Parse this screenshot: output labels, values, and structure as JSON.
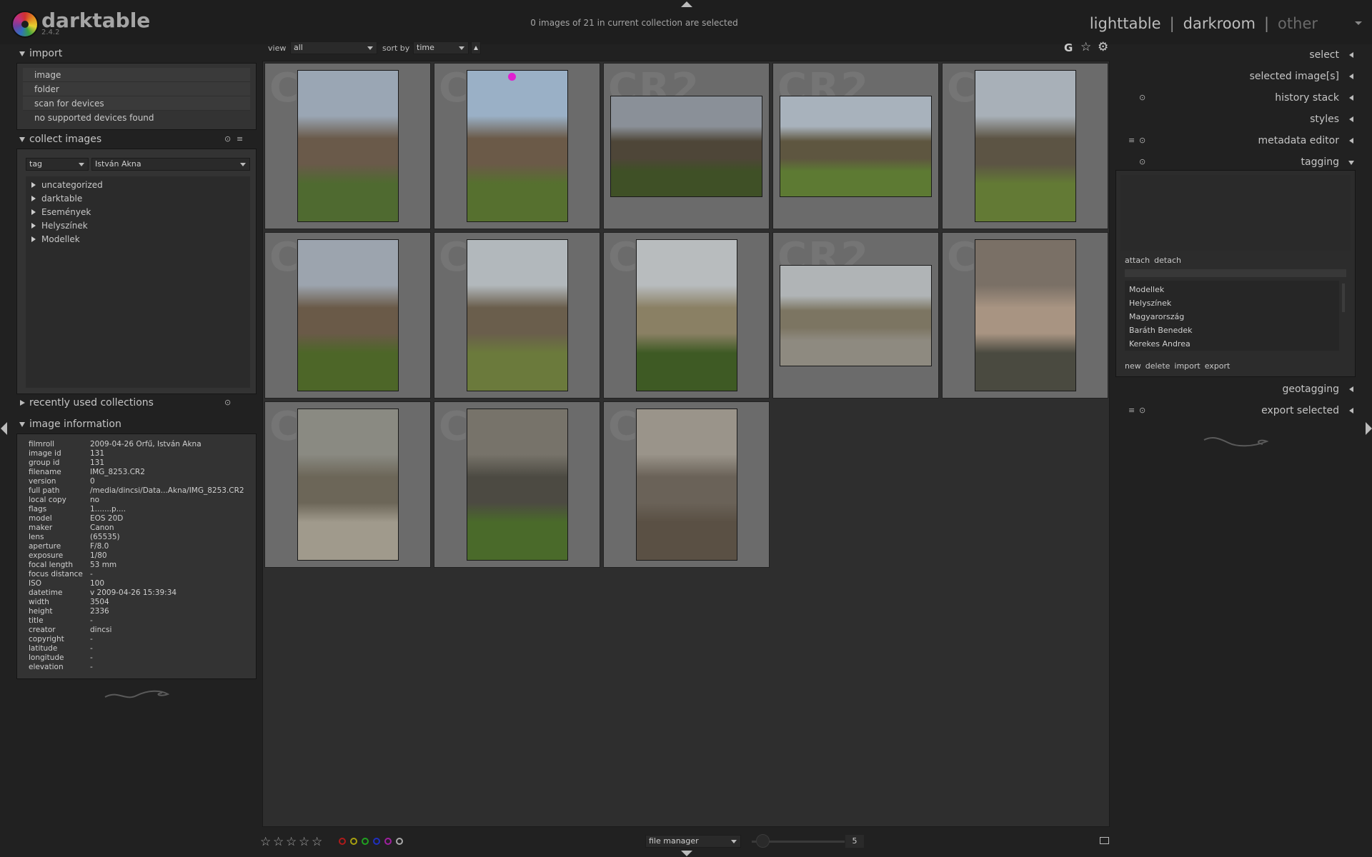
{
  "app": {
    "name": "darktable",
    "version": "2.4.2"
  },
  "header": {
    "selection_info": "0 images of 21 in current collection are selected",
    "views": {
      "lighttable": "lighttable",
      "sep": "|",
      "darkroom": "darkroom",
      "other": "other"
    }
  },
  "left": {
    "import": {
      "title": "import",
      "items": [
        "image",
        "folder",
        "scan for devices"
      ],
      "note": "no supported devices found"
    },
    "collect": {
      "title": "collect images",
      "property": "tag",
      "value": "István Akna",
      "tree": [
        "uncategorized",
        "darktable",
        "Események",
        "Helyszínek",
        "Modellek"
      ]
    },
    "recent": {
      "title": "recently used collections"
    },
    "info": {
      "title": "image information",
      "rows": [
        {
          "k": "filmroll",
          "v": "2009-04-26 Orfű, István Akna"
        },
        {
          "k": "image id",
          "v": "131"
        },
        {
          "k": "group id",
          "v": "131"
        },
        {
          "k": "filename",
          "v": "IMG_8253.CR2"
        },
        {
          "k": "version",
          "v": "0"
        },
        {
          "k": "full path",
          "v": "/media/dincsi/Data...Akna/IMG_8253.CR2"
        },
        {
          "k": "local copy",
          "v": "no"
        },
        {
          "k": "flags",
          "v": "1.......p...."
        },
        {
          "k": "model",
          "v": "EOS 20D"
        },
        {
          "k": "maker",
          "v": "Canon"
        },
        {
          "k": "lens",
          "v": "(65535)"
        },
        {
          "k": "aperture",
          "v": "F/8.0"
        },
        {
          "k": "exposure",
          "v": "1/80"
        },
        {
          "k": "focal length",
          "v": "53 mm"
        },
        {
          "k": "focus distance",
          "v": "-"
        },
        {
          "k": "ISO",
          "v": "100"
        },
        {
          "k": "datetime",
          "v": "v 2009-04-26 15:39:34"
        },
        {
          "k": "width",
          "v": "3504"
        },
        {
          "k": "height",
          "v": "2336"
        },
        {
          "k": "title",
          "v": "-"
        },
        {
          "k": "creator",
          "v": "dincsi"
        },
        {
          "k": "copyright",
          "v": "-"
        },
        {
          "k": "latitude",
          "v": "-"
        },
        {
          "k": "longitude",
          "v": "-"
        },
        {
          "k": "elevation",
          "v": "-"
        }
      ]
    }
  },
  "toolbar": {
    "view_label": "view",
    "view_value": "all",
    "sort_label": "sort by",
    "sort_value": "time",
    "g_label": "G"
  },
  "grid": {
    "watermark": "CR2",
    "images": [
      {
        "orient": "portrait",
        "colors": [
          "#9aa6b4",
          "#6a5a4a",
          "#4f6a30"
        ]
      },
      {
        "orient": "portrait",
        "colors": [
          "#9ab0c6",
          "#6b5a48",
          "#56702f"
        ],
        "mark": true
      },
      {
        "orient": "landscape",
        "colors": [
          "#8a9098",
          "#4e4638",
          "#3f5026"
        ]
      },
      {
        "orient": "landscape",
        "colors": [
          "#a8b2bc",
          "#5e5640",
          "#5d7a33"
        ]
      },
      {
        "orient": "portrait",
        "colors": [
          "#a8b0b8",
          "#5c5444",
          "#637a35"
        ]
      },
      {
        "orient": "portrait",
        "colors": [
          "#9ca4ae",
          "#6a5a48",
          "#4d6628"
        ]
      },
      {
        "orient": "portrait",
        "colors": [
          "#b2b8bc",
          "#6a5e4c",
          "#6b7a3c"
        ]
      },
      {
        "orient": "portrait",
        "colors": [
          "#b8bcbe",
          "#8a8064",
          "#3e5a24"
        ]
      },
      {
        "orient": "landscape",
        "colors": [
          "#b0b4b6",
          "#7c7562",
          "#8e8a80"
        ]
      },
      {
        "orient": "portrait",
        "colors": [
          "#7a7066",
          "#a89482",
          "#4a4a40"
        ]
      },
      {
        "orient": "portrait",
        "colors": [
          "#8a8a82",
          "#6c6658",
          "#a09a8c"
        ]
      },
      {
        "orient": "portrait",
        "colors": [
          "#77736a",
          "#4c4a42",
          "#4a6a2a"
        ]
      },
      {
        "orient": "portrait",
        "colors": [
          "#9a948a",
          "#6a6258",
          "#5a5044"
        ]
      }
    ]
  },
  "right": {
    "sections": {
      "select": "select",
      "selected": "selected image[s]",
      "history": "history stack",
      "styles": "styles",
      "metadata": "metadata editor",
      "tagging": "tagging",
      "geotagging": "geotagging",
      "export": "export selected"
    },
    "tagging": {
      "attach": "attach",
      "detach": "detach",
      "list": [
        "Modellek",
        "Helyszínek",
        "Magyarország",
        "Baráth Benedek",
        "Kerekes Andrea"
      ],
      "buttons": [
        "new",
        "delete",
        "import",
        "export"
      ]
    }
  },
  "bottom": {
    "stars": 5,
    "color_labels": [
      "#b01a1a",
      "#a8a010",
      "#20a020",
      "#2030c0",
      "#a020a0",
      "#a8a8a8"
    ],
    "layout": "file manager",
    "zoom": "5"
  },
  "icons": {
    "star": "star-icon",
    "gear": "gear-icon",
    "presets": "presets-icon",
    "reset": "reset-icon",
    "display": "display-icon"
  }
}
